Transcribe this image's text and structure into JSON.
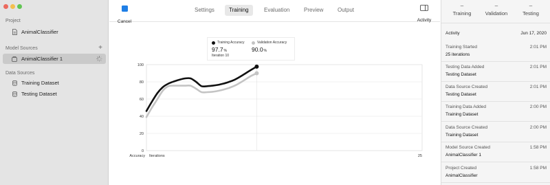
{
  "sidebar": {
    "project_heading": "Project",
    "project_item": "AnimalClassifier",
    "model_sources_heading": "Model Sources",
    "add_symbol": "+",
    "model_source_item": "AnimalClassifier 1",
    "data_sources_heading": "Data Sources",
    "data_source_items": [
      "Training Dataset",
      "Testing Dataset"
    ]
  },
  "toolbar": {
    "cancel_label": "Cancel",
    "tabs": [
      "Settings",
      "Training",
      "Evaluation",
      "Preview",
      "Output"
    ],
    "active_tab": "Training",
    "activity_label": "Activity",
    "accent_color": "#1f7fe6"
  },
  "legend": {
    "training": {
      "title": "Training Accuracy",
      "value": "97.7",
      "unit": "%",
      "iteration": "Iteration 10"
    },
    "validation": {
      "title": "Validation Accuracy",
      "value": "90.0",
      "unit": "%"
    }
  },
  "chart_data": {
    "type": "line",
    "ylabel": "Accuracy",
    "xlabel": "Iterations",
    "xlim": [
      0,
      25
    ],
    "ylim": [
      0,
      100
    ],
    "yticks": [
      "0",
      "20",
      "40",
      "60",
      "80",
      "100"
    ],
    "x_end_label": "25",
    "hover_x": 10,
    "series": [
      {
        "name": "Training Accuracy",
        "color": "#111111",
        "x": [
          0,
          0.5,
          1,
          1.5,
          2,
          2.5,
          3,
          3.5,
          4,
          4.5,
          5,
          5.5,
          6,
          6.5,
          7,
          7.5,
          8,
          8.5,
          9,
          9.5,
          10
        ],
        "values": [
          46,
          57,
          67,
          74,
          78,
          80.5,
          82.5,
          84,
          84,
          80,
          75,
          75,
          75.5,
          76.5,
          78,
          80,
          82.5,
          86,
          90,
          94,
          97.7
        ]
      },
      {
        "name": "Validation Accuracy",
        "color": "#c4c4c4",
        "x": [
          0,
          0.5,
          1,
          1.5,
          2,
          2.5,
          3,
          3.5,
          4,
          4.5,
          5,
          5.5,
          6,
          6.5,
          7,
          7.5,
          8,
          8.5,
          9,
          9.5,
          10
        ],
        "values": [
          39,
          50,
          60,
          70,
          75,
          75.5,
          75.5,
          75.5,
          75.5,
          72,
          68,
          68,
          68.5,
          69.5,
          71,
          73,
          75.5,
          79,
          83,
          87,
          90
        ]
      }
    ]
  },
  "right_panel": {
    "metrics": [
      {
        "value": "–",
        "label": "Training"
      },
      {
        "value": "–",
        "label": "Validation"
      },
      {
        "value": "–",
        "label": "Testing"
      }
    ],
    "activity_heading": "Activity",
    "activity_date": "Jun 17, 2020",
    "entries": [
      {
        "title": "Training Started",
        "time": "2:01 PM",
        "detail": "25 iterations"
      },
      {
        "title": "Testing Data Added",
        "time": "2:01 PM",
        "detail": "Testing Dataset"
      },
      {
        "title": "Data Source Created",
        "time": "2:01 PM",
        "detail": "Testing Dataset"
      },
      {
        "title": "Training Data Added",
        "time": "2:00 PM",
        "detail": "Training Dataset"
      },
      {
        "title": "Data Source Created",
        "time": "2:00 PM",
        "detail": "Training Dataset"
      },
      {
        "title": "Model Source Created",
        "time": "1:58 PM",
        "detail": "AnimalClassifier 1"
      },
      {
        "title": "Project Created",
        "time": "1:58 PM",
        "detail": "AnimalClassifier"
      }
    ]
  }
}
